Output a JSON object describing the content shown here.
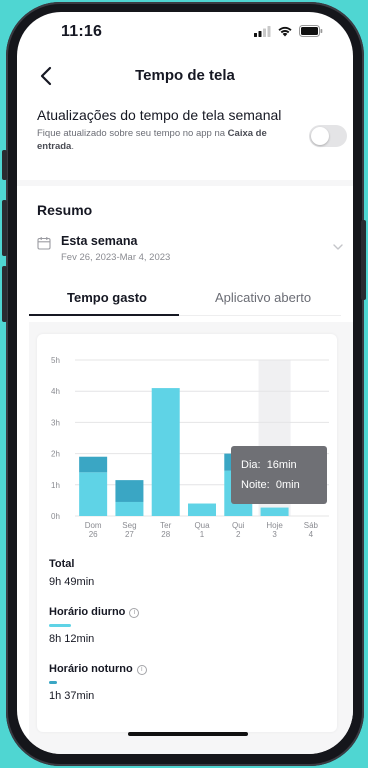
{
  "status": {
    "time": "11:16"
  },
  "nav": {
    "title": "Tempo de tela"
  },
  "weekly": {
    "title": "Atualizações do tempo de tela semanal",
    "desc_prefix": "Fique atualizado sobre seu tempo no app na ",
    "desc_link": "Caixa de entrada",
    "desc_suffix": ".",
    "toggle_on": false
  },
  "summary": {
    "title": "Resumo",
    "period_name": "Esta semana",
    "period_range": "Fev 26, 2023-Mar 4, 2023"
  },
  "tabs": [
    {
      "label": "Tempo gasto",
      "active": true
    },
    {
      "label": "Aplicativo aberto",
      "active": false
    }
  ],
  "chart_data": {
    "type": "bar",
    "stacked": true,
    "categories": [
      {
        "day": "Dom",
        "date": "26"
      },
      {
        "day": "Seg",
        "date": "27"
      },
      {
        "day": "Ter",
        "date": "28"
      },
      {
        "day": "Qua",
        "date": "1"
      },
      {
        "day": "Qui",
        "date": "2"
      },
      {
        "day": "Hoje",
        "date": "3"
      },
      {
        "day": "Sáb",
        "date": "4"
      }
    ],
    "y_ticks": [
      "5h",
      "4h",
      "3h",
      "2h",
      "1h",
      "0h"
    ],
    "ylim": [
      0,
      5
    ],
    "highlighted_index": 5,
    "series": [
      {
        "name": "Horário diurno",
        "color": "#5fd3e6",
        "values": [
          1.4,
          0.45,
          4.1,
          0.4,
          1.45,
          0.27,
          0
        ]
      },
      {
        "name": "Horário noturno",
        "color": "#3aa6c4",
        "values": [
          0.5,
          0.7,
          0,
          0,
          0.55,
          0,
          0
        ]
      }
    ],
    "tooltip": {
      "line1_label": "Dia:",
      "line1_value": "16min",
      "line2_label": "Noite:",
      "line2_value": "0min"
    }
  },
  "stats": {
    "total_label": "Total",
    "total_value": "9h 49min",
    "day_label": "Horário diurno",
    "day_value": "8h 12min",
    "night_label": "Horário noturno",
    "night_value": "1h 37min"
  },
  "colors": {
    "day": "#5fd3e6",
    "night": "#3aa6c4",
    "highlight": "#f0f0f2",
    "axis": "#e4e4e6"
  }
}
